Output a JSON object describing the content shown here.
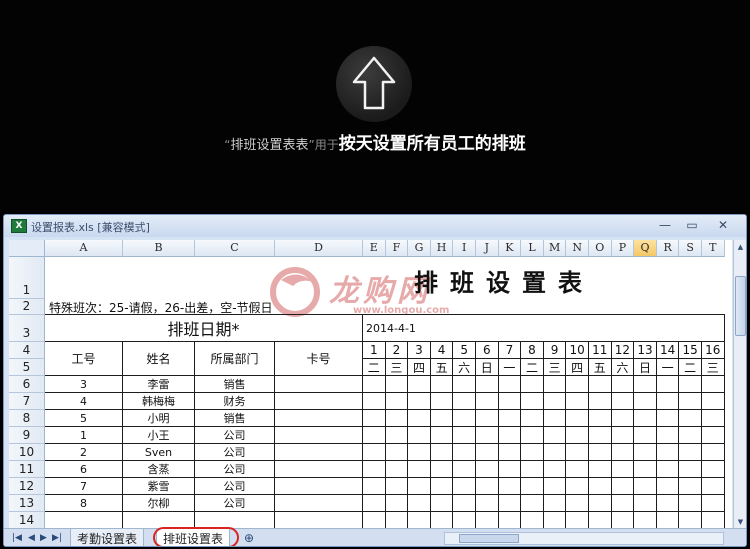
{
  "banner": {
    "quote_open": "“",
    "sheet_name": "排班设置表表",
    "quote_close": "”",
    "mid_text": "用于",
    "main_text": "按天设置所有员工的排班"
  },
  "window": {
    "title": "设置报表.xls  [兼容模式]",
    "icon_text": "X",
    "min_label": "—",
    "max_label": "▭",
    "close_label": "✕"
  },
  "watermark": {
    "text": "龙购网",
    "url": "www.longou.com"
  },
  "columns": [
    "A",
    "B",
    "C",
    "D",
    "E",
    "F",
    "G",
    "H",
    "I",
    "J",
    "K",
    "L",
    "M",
    "N",
    "O",
    "P",
    "Q",
    "R",
    "S",
    "T"
  ],
  "selected_column": "Q",
  "rows": [
    "1",
    "2",
    "3",
    "4",
    "5",
    "6",
    "7",
    "8",
    "9",
    "10",
    "11",
    "12",
    "13",
    "14"
  ],
  "sheet": {
    "title": "排班设置表",
    "special_shifts": "特殊班次：25-请假，26-出差，空-节假日",
    "schedule_date_label": "排班日期*",
    "start_date": "2014-4-1",
    "headers": {
      "id": "工号",
      "name": "姓名",
      "dept": "所属部门",
      "card": "卡号"
    },
    "day_numbers": [
      "1",
      "2",
      "3",
      "4",
      "5",
      "6",
      "7",
      "8",
      "9",
      "10",
      "11",
      "12",
      "13",
      "14",
      "15",
      "16"
    ],
    "weekdays": [
      "二",
      "三",
      "四",
      "五",
      "六",
      "日",
      "一",
      "二",
      "三",
      "四",
      "五",
      "六",
      "日",
      "一",
      "二",
      "三"
    ],
    "employees": [
      {
        "id": "3",
        "name": "李雷",
        "dept": "销售"
      },
      {
        "id": "4",
        "name": "韩梅梅",
        "dept": "财务"
      },
      {
        "id": "5",
        "name": "小明",
        "dept": "销售"
      },
      {
        "id": "1",
        "name": "小王",
        "dept": "公司"
      },
      {
        "id": "2",
        "name": "Sven",
        "dept": "公司"
      },
      {
        "id": "6",
        "name": "含蒸",
        "dept": "公司"
      },
      {
        "id": "7",
        "name": "紫雪",
        "dept": "公司"
      },
      {
        "id": "8",
        "name": "尔柳",
        "dept": "公司"
      }
    ]
  },
  "tabs": {
    "first": "考勤设置表",
    "second": "排班设置表"
  },
  "colors": {
    "highlight_ring": "#d8231f",
    "selected_col": "#f6c865"
  }
}
